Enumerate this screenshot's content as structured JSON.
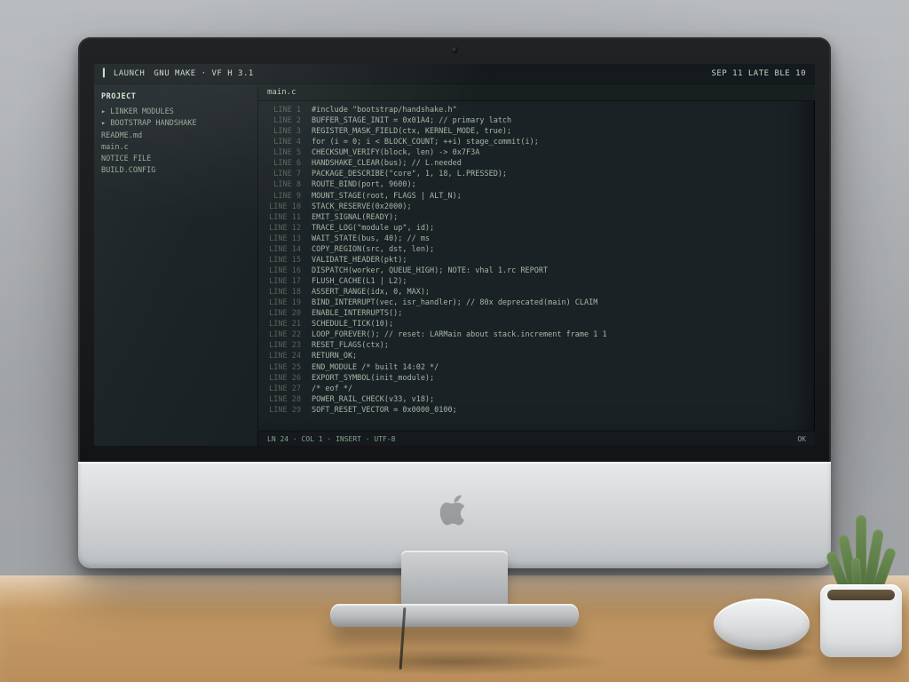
{
  "note": "Photograph of an iMac on a wooden desk showing a dark code-editor window. On-screen text is small and not legibly resolvable; entries below are illustrative placeholders matching visual density, not literal transcription.",
  "topbar": {
    "left": "▍ LAUNCH",
    "center": "GNU  MAKE  ·  VF H  3.1",
    "right": "SEP  11  LATE BLE  10"
  },
  "sidebar": {
    "header": "PROJECT",
    "items": [
      "▸ LINKER  MODULES",
      "▸ BOOTSTRAP  HANDSHAKE",
      "  README.md",
      "  main.c",
      "  NOTICE  FILE",
      "  BUILD.CONFIG"
    ]
  },
  "tab": {
    "label": "main.c"
  },
  "lines": [
    {
      "n": "1",
      "t": "#include \"bootstrap/handshake.h\""
    },
    {
      "n": "2",
      "t": "BUFFER_STAGE_INIT   = 0x01A4;   // primary latch"
    },
    {
      "n": "3",
      "t": "REGISTER_MASK_FIELD(ctx, KERNEL_MODE, true);"
    },
    {
      "n": "4",
      "t": "for (i = 0; i < BLOCK_COUNT; ++i) stage_commit(i);"
    },
    {
      "n": "5",
      "t": "CHECKSUM_VERIFY(block, len)  ->  0x7F3A"
    },
    {
      "n": "6",
      "t": "HANDSHAKE_CLEAR(bus);         // L.needed"
    },
    {
      "n": "7",
      "t": "PACKAGE_DESCRIBE(\"core\", 1, 18, L.PRESSED);"
    },
    {
      "n": "8",
      "t": "ROUTE_BIND(port, 9600);"
    },
    {
      "n": "9",
      "t": "MOUNT_STAGE(root, FLAGS | ALT_N);"
    },
    {
      "n": "10",
      "t": "STACK_RESERVE(0x2000);"
    },
    {
      "n": "11",
      "t": "EMIT_SIGNAL(READY);"
    },
    {
      "n": "12",
      "t": "TRACE_LOG(\"module up\", id);"
    },
    {
      "n": "13",
      "t": "WAIT_STATE(bus, 40);                         // ms"
    },
    {
      "n": "14",
      "t": "COPY_REGION(src, dst, len);"
    },
    {
      "n": "15",
      "t": "VALIDATE_HEADER(pkt);"
    },
    {
      "n": "16",
      "t": "DISPATCH(worker, QUEUE_HIGH);    NOTE: vhal 1.rc  REPORT"
    },
    {
      "n": "17",
      "t": "FLUSH_CACHE(L1 | L2);"
    },
    {
      "n": "18",
      "t": "ASSERT_RANGE(idx, 0, MAX);"
    },
    {
      "n": "19",
      "t": "BIND_INTERRUPT(vec, isr_handler);            // 80x  deprecated(main) CLAIM"
    },
    {
      "n": "20",
      "t": "ENABLE_INTERRUPTS();"
    },
    {
      "n": "21",
      "t": "SCHEDULE_TICK(10);"
    },
    {
      "n": "22",
      "t": "LOOP_FOREVER();     // reset: LARMain about stack.increment  frame 1 1"
    },
    {
      "n": "23",
      "t": "RESET_FLAGS(ctx);"
    },
    {
      "n": "24",
      "t": "RETURN_OK;"
    },
    {
      "n": "25",
      "t": "END_MODULE   /* built 14:02 */"
    },
    {
      "n": "26",
      "t": "EXPORT_SYMBOL(init_module);"
    },
    {
      "n": "27",
      "t": "/* eof */"
    },
    {
      "n": "28",
      "t": "POWER_RAIL_CHECK(v33, v18);"
    },
    {
      "n": "29",
      "t": "SOFT_RESET_VECTOR = 0x0000_0100;"
    }
  ],
  "status": {
    "left": "LN 24 · COL 1 · INSERT · UTF-8",
    "right": "OK"
  }
}
